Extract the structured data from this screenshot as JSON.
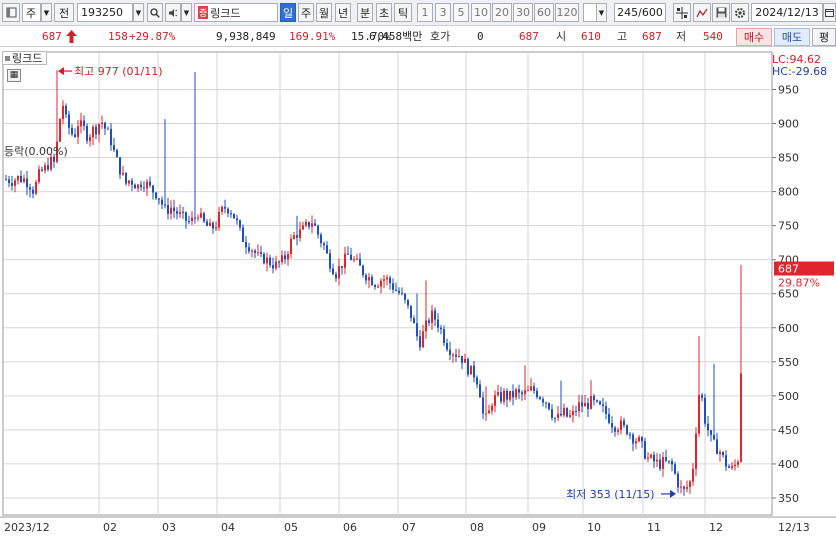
{
  "toolbar": {
    "unit_label": "주",
    "market_label": "전",
    "code": "193250",
    "stock_name": "링크드",
    "stock_badge": "증",
    "periods": [
      "일",
      "주",
      "월",
      "년",
      "분",
      "초",
      "틱"
    ],
    "intervals": [
      "1",
      "3",
      "5",
      "10",
      "20",
      "30",
      "60",
      "120"
    ],
    "count": "245/600",
    "date": "2024/12/13"
  },
  "quote": {
    "price": "687",
    "change": "158",
    "change_pct": "+29.87%",
    "volume": "9,938,849",
    "volume_ratio": "169.91%",
    "turnover": "15.70%",
    "amount": "6,458백만",
    "hoga_label": "호가",
    "hoga_value": "0",
    "ask": "687",
    "open_label": "시",
    "open": "610",
    "high_label": "고",
    "high": "687",
    "low_label": "저",
    "low": "540",
    "buy_label": "매수",
    "sell_label": "매도",
    "eval_label": "평"
  },
  "chart_data": {
    "type": "candlestick",
    "series_name": "링크드",
    "ylim": [
      325,
      1005
    ],
    "y_ticks": [
      350,
      400,
      450,
      500,
      550,
      600,
      650,
      700,
      750,
      800,
      850,
      900,
      950
    ],
    "x_ticks": [
      "2023/12",
      "02",
      "03",
      "04",
      "05",
      "06",
      "07",
      "08",
      "09",
      "10",
      "11",
      "12",
      "12/13"
    ],
    "lc_label": "LC:94.62",
    "hc_label": "HC:-29.68",
    "current_price_label": "687",
    "current_pct_label": "29.87%",
    "high_annotation": "최고 977 (01/11)",
    "low_annotation": "최저 353 (11/15)",
    "baseline_annotation": "등락(0.00%)",
    "high_value": 977,
    "low_value": 353,
    "last_close": 687,
    "colors": {
      "up": "#e1252d",
      "down": "#1f4fbf",
      "grid": "#d6d6d6",
      "annotation_up": "#d1202a",
      "annotation_down": "#1f3fb0"
    },
    "path": [
      [
        0,
        818
      ],
      [
        6,
        816
      ],
      [
        12,
        820
      ],
      [
        18,
        818
      ],
      [
        23,
        812
      ],
      [
        28,
        800
      ],
      [
        32,
        822
      ],
      [
        36,
        830
      ],
      [
        40,
        835
      ],
      [
        44,
        845
      ],
      [
        48,
        842
      ],
      [
        52,
        880
      ],
      [
        56,
        935
      ],
      [
        60,
        905
      ],
      [
        64,
        890
      ],
      [
        68,
        880
      ],
      [
        72,
        900
      ],
      [
        78,
        892
      ],
      [
        82,
        880
      ],
      [
        86,
        890
      ],
      [
        90,
        893
      ],
      [
        95,
        905
      ],
      [
        100,
        890
      ],
      [
        104,
        880
      ],
      [
        108,
        858
      ],
      [
        112,
        840
      ],
      [
        116,
        825
      ],
      [
        120,
        812
      ],
      [
        124,
        818
      ],
      [
        128,
        812
      ],
      [
        132,
        808
      ],
      [
        136,
        815
      ],
      [
        140,
        812
      ],
      [
        144,
        805
      ],
      [
        148,
        800
      ],
      [
        152,
        795
      ],
      [
        156,
        782
      ],
      [
        160,
        770
      ],
      [
        164,
        778
      ],
      [
        168,
        772
      ],
      [
        172,
        768
      ],
      [
        176,
        762
      ],
      [
        180,
        758
      ],
      [
        184,
        755
      ],
      [
        188,
        760
      ],
      [
        192,
        770
      ],
      [
        196,
        756
      ],
      [
        200,
        750
      ],
      [
        205,
        745
      ],
      [
        210,
        752
      ],
      [
        215,
        770
      ],
      [
        220,
        778
      ],
      [
        225,
        772
      ],
      [
        230,
        758
      ],
      [
        234,
        740
      ],
      [
        238,
        728
      ],
      [
        242,
        722
      ],
      [
        246,
        716
      ],
      [
        250,
        708
      ],
      [
        254,
        700
      ],
      [
        258,
        702
      ],
      [
        262,
        698
      ],
      [
        266,
        694
      ],
      [
        270,
        692
      ],
      [
        274,
        696
      ],
      [
        278,
        700
      ],
      [
        282,
        715
      ],
      [
        286,
        730
      ],
      [
        290,
        738
      ],
      [
        294,
        740
      ],
      [
        298,
        745
      ],
      [
        302,
        752
      ],
      [
        306,
        756
      ],
      [
        310,
        745
      ],
      [
        314,
        730
      ],
      [
        318,
        720
      ],
      [
        322,
        702
      ],
      [
        326,
        690
      ],
      [
        330,
        680
      ],
      [
        334,
        690
      ],
      [
        338,
        698
      ],
      [
        342,
        706
      ],
      [
        346,
        702
      ],
      [
        350,
        695
      ],
      [
        354,
        688
      ],
      [
        358,
        680
      ],
      [
        362,
        675
      ],
      [
        366,
        670
      ],
      [
        370,
        665
      ],
      [
        374,
        670
      ],
      [
        378,
        672
      ],
      [
        382,
        670
      ],
      [
        386,
        662
      ],
      [
        390,
        655
      ],
      [
        394,
        650
      ],
      [
        398,
        640
      ],
      [
        402,
        628
      ],
      [
        406,
        615
      ],
      [
        410,
        590
      ],
      [
        414,
        580
      ],
      [
        418,
        595
      ],
      [
        422,
        610
      ],
      [
        426,
        618
      ],
      [
        430,
        612
      ],
      [
        434,
        600
      ],
      [
        438,
        585
      ],
      [
        442,
        572
      ],
      [
        446,
        566
      ],
      [
        450,
        562
      ],
      [
        454,
        560
      ],
      [
        458,
        550
      ],
      [
        462,
        540
      ],
      [
        466,
        534
      ],
      [
        470,
        530
      ],
      [
        474,
        505
      ],
      [
        478,
        462
      ],
      [
        482,
        470
      ],
      [
        486,
        492
      ],
      [
        490,
        498
      ],
      [
        494,
        496
      ],
      [
        498,
        502
      ],
      [
        502,
        498
      ],
      [
        506,
        500
      ],
      [
        510,
        505
      ],
      [
        514,
        500
      ],
      [
        518,
        503
      ],
      [
        522,
        505
      ],
      [
        526,
        510
      ],
      [
        530,
        506
      ],
      [
        534,
        500
      ],
      [
        538,
        495
      ],
      [
        542,
        490
      ],
      [
        546,
        475
      ],
      [
        550,
        465
      ],
      [
        554,
        470
      ],
      [
        558,
        475
      ],
      [
        562,
        468
      ],
      [
        566,
        470
      ],
      [
        570,
        480
      ],
      [
        574,
        488
      ],
      [
        578,
        485
      ],
      [
        582,
        488
      ],
      [
        586,
        492
      ],
      [
        590,
        485
      ],
      [
        594,
        482
      ],
      [
        598,
        478
      ],
      [
        602,
        470
      ],
      [
        606,
        460
      ],
      [
        610,
        455
      ],
      [
        614,
        458
      ],
      [
        618,
        452
      ],
      [
        622,
        450
      ],
      [
        626,
        440
      ],
      [
        630,
        436
      ],
      [
        634,
        432
      ],
      [
        638,
        418
      ],
      [
        642,
        408
      ],
      [
        646,
        405
      ],
      [
        650,
        402
      ],
      [
        654,
        400
      ],
      [
        658,
        403
      ],
      [
        662,
        400
      ],
      [
        666,
        398
      ],
      [
        670,
        380
      ],
      [
        674,
        364
      ],
      [
        678,
        360
      ],
      [
        682,
        368
      ],
      [
        686,
        378
      ],
      [
        690,
        452
      ],
      [
        694,
        520
      ],
      [
        698,
        470
      ],
      [
        702,
        450
      ],
      [
        706,
        430
      ],
      [
        710,
        425
      ],
      [
        714,
        418
      ],
      [
        718,
        405
      ],
      [
        722,
        395
      ],
      [
        726,
        392
      ],
      [
        730,
        400
      ],
      [
        733,
        412
      ],
      [
        736,
        600
      ],
      [
        738,
        640
      ]
    ],
    "spikes": [
      [
        52,
        977
      ],
      [
        160,
        900
      ],
      [
        190,
        965
      ],
      [
        290,
        760
      ],
      [
        345,
        710
      ],
      [
        412,
        645
      ],
      [
        420,
        660
      ],
      [
        480,
        510
      ],
      [
        520,
        535
      ],
      [
        555,
        515
      ],
      [
        585,
        520
      ],
      [
        694,
        578
      ],
      [
        707,
        545
      ],
      [
        735,
        685
      ]
    ]
  }
}
